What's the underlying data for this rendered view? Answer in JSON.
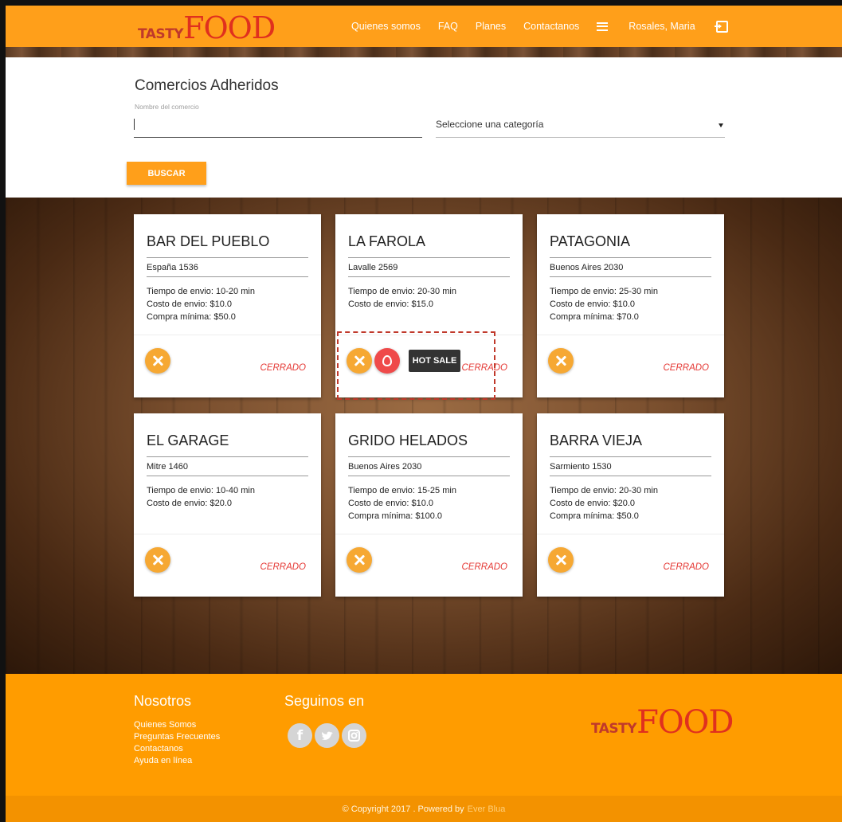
{
  "nav": {
    "logo_tasty": "TASTY",
    "logo_food": "FOOD",
    "links": [
      "Quienes somos",
      "FAQ",
      "Planes",
      "Contactanos"
    ],
    "user": "Rosales, Maria"
  },
  "search": {
    "title": "Comercios Adheridos",
    "name_label": "Nombre del comercio",
    "name_value": "",
    "category_placeholder": "Seleccione una categoría",
    "button_label": "BUSCAR"
  },
  "cards": [
    {
      "name": "BAR DEL PUEBLO",
      "address": "España 1536",
      "info": [
        "Tiempo de envio: 10-20 min",
        "Costo de envio: $10.0",
        "Compra mínima: $50.0"
      ],
      "status": "CERRADO",
      "hot_sale": false
    },
    {
      "name": "LA FAROLA",
      "address": "Lavalle 2569",
      "info": [
        "Tiempo de envio: 20-30 min",
        "Costo de envio: $15.0"
      ],
      "status": "CERRADO",
      "hot_sale": true,
      "hot_sale_label": "HOT SALE"
    },
    {
      "name": "PATAGONIA",
      "address": "Buenos Aires 2030",
      "info": [
        "Tiempo de envio: 25-30 min",
        "Costo de envio: $10.0",
        "Compra mínima: $70.0"
      ],
      "status": "CERRADO",
      "hot_sale": false
    },
    {
      "name": "EL GARAGE",
      "address": "Mitre 1460",
      "info": [
        "Tiempo de envio: 10-40 min",
        "Costo de envio: $20.0"
      ],
      "status": "CERRADO",
      "hot_sale": false
    },
    {
      "name": "GRIDO HELADOS",
      "address": "Buenos Aires 2030",
      "info": [
        "Tiempo de envio: 15-25 min",
        "Costo de envio: $10.0",
        "Compra mínima: $100.0"
      ],
      "status": "CERRADO",
      "hot_sale": false
    },
    {
      "name": "BARRA VIEJA",
      "address": "Sarmiento 1530",
      "info": [
        "Tiempo de envio: 20-30 min",
        "Costo de envio: $20.0",
        "Compra mínima: $50.0"
      ],
      "status": "CERRADO",
      "hot_sale": false
    }
  ],
  "footer": {
    "nosotros_title": "Nosotros",
    "links": [
      "Quienes Somos",
      "Preguntas Frecuentes",
      "Contactanos",
      "Ayuda en línea"
    ],
    "seguinos_title": "Seguinos en",
    "social_icons": [
      "facebook-icon",
      "twitter-icon",
      "instagram-icon"
    ],
    "logo_tasty": "TASTY",
    "logo_food": "FOOD",
    "copyright": "© Copyright 2017 . Powered by",
    "powered_brand": "Ever Blua"
  },
  "colors": {
    "brand_orange": "#ff9f1a",
    "status_red": "#e53935",
    "hot_sale_red": "#ef4a4a"
  }
}
